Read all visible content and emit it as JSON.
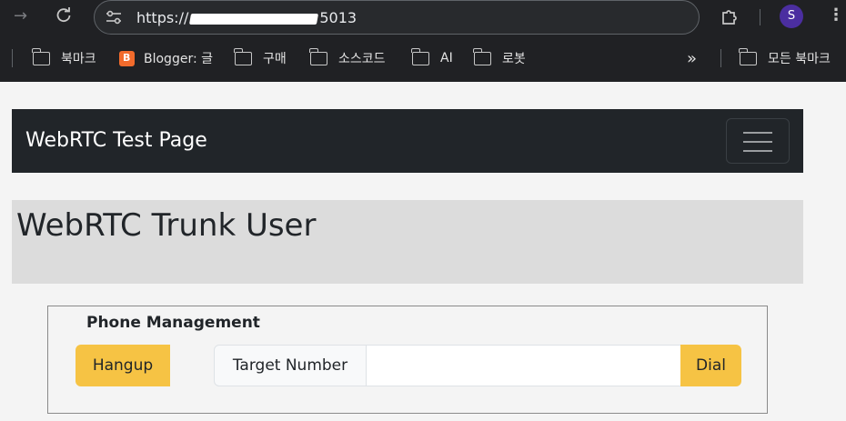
{
  "browser": {
    "url_prefix": "https://",
    "url_suffix": "5013",
    "profile_initial": "S",
    "bookmarks": [
      {
        "label": "북마크",
        "icon": "folder-icon"
      },
      {
        "label": "Blogger: 글",
        "icon": "blogger-icon"
      },
      {
        "label": "구매",
        "icon": "folder-icon"
      },
      {
        "label": "소스코드",
        "icon": "folder-icon"
      },
      {
        "label": "AI",
        "icon": "folder-icon"
      },
      {
        "label": "로봇",
        "icon": "folder-icon"
      }
    ],
    "overflow_label": "»",
    "all_bookmarks_label": "모든 북마크"
  },
  "navbar": {
    "brand": "WebRTC Test Page"
  },
  "jumbotron": {
    "title": "WebRTC Trunk User"
  },
  "phone": {
    "title": "Phone Management",
    "hangup_label": "Hangup",
    "target_label": "Target Number",
    "target_value": "",
    "dial_label": "Dial"
  },
  "colors": {
    "chrome_bg": "#202124",
    "navbar_bg": "#212529",
    "jumbotron_bg": "#dcdcdc",
    "button_yellow": "#f6c344",
    "avatar_purple": "#4b2ea0"
  }
}
